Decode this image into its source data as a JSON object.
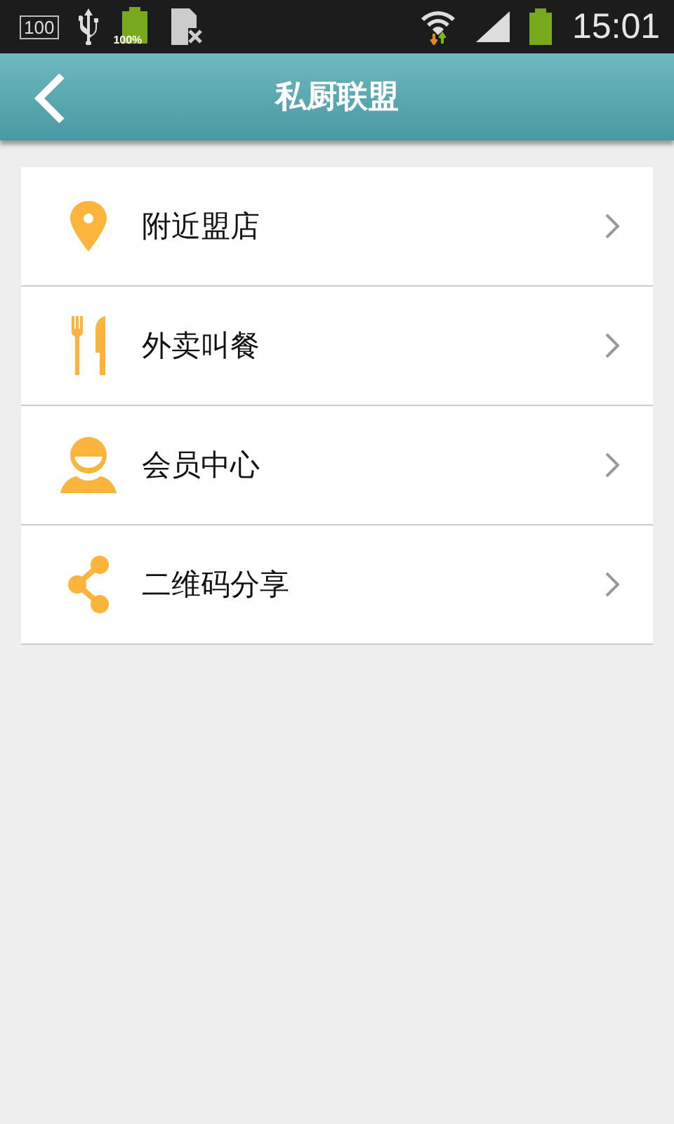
{
  "status_bar": {
    "notifications": [
      {
        "kind": "boxed",
        "text": "100"
      },
      {
        "kind": "usb"
      },
      {
        "kind": "battery",
        "text": "100%"
      },
      {
        "kind": "sim"
      }
    ],
    "time": "15:01"
  },
  "header": {
    "title": "私厨联盟"
  },
  "menu": [
    {
      "kind": "pin",
      "label": "附近盟店"
    },
    {
      "kind": "cutlery",
      "label": "外卖叫餐"
    },
    {
      "kind": "person",
      "label": "会员中心"
    },
    {
      "kind": "share",
      "label": "二维码分享"
    }
  ]
}
